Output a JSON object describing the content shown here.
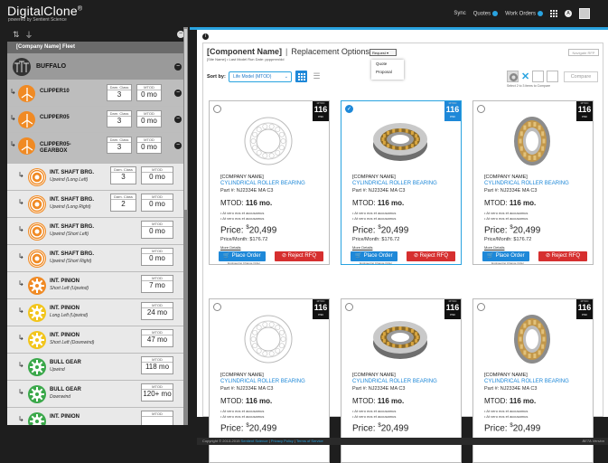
{
  "header": {
    "brand": "DigitalClone",
    "brand_mark": "®",
    "brand_sub": "powered by Sentient Science",
    "nav_label": "Sync",
    "quotes_label": "Quotes",
    "work_orders_label": "Work Orders"
  },
  "sidebar": {
    "fleet_label": "[Company Name] Fleet",
    "site_label": "BUFFALO",
    "turbines": [
      {
        "name": "CLIPPER10",
        "damage_label": "Dam. Class",
        "damage": "3",
        "mtod_label": "MTOD",
        "mtod": "0 mo"
      },
      {
        "name": "CLIPPER05",
        "damage_label": "Dam. Class",
        "damage": "3",
        "mtod_label": "MTOD",
        "mtod": "0 mo"
      },
      {
        "name": "CLIPPER05-",
        "name2": "GEARBOX",
        "damage_label": "Dam. Class",
        "damage": "3",
        "mtod_label": "MTOD",
        "mtod": "0 mo"
      }
    ],
    "components": [
      {
        "name": "INT. SHAFT BRG.",
        "sub": "Upwind (Long Left)",
        "damage_label": "Dam. Class",
        "damage": "3",
        "mtod_label": "MTOD",
        "mtod": "0 mo",
        "color": "#f08a24"
      },
      {
        "name": "INT. SHAFT BRG.",
        "sub": "Upwind (Long Right)",
        "damage_label": "Dam. Class",
        "damage": "2",
        "mtod_label": "MTOD",
        "mtod": "0 mo",
        "color": "#f08a24"
      },
      {
        "name": "INT. SHAFT BRG.",
        "sub": "Upwind (Short Left)",
        "mtod_label": "MTOD",
        "mtod": "0 mo",
        "color": "#f08a24"
      },
      {
        "name": "INT. SHAFT BRG.",
        "sub": "Upwind (Short Right)",
        "mtod_label": "MTOD",
        "mtod": "0 mo",
        "color": "#f08a24"
      },
      {
        "name": "INT. PINION",
        "sub": "Short Left (Upwind)",
        "mtod_label": "MTOD",
        "mtod": "7 mo",
        "color": "#f08a24"
      },
      {
        "name": "INT. PINION",
        "sub": "Long Left (Upwind)",
        "mtod_label": "MTOD",
        "mtod": "24 mo",
        "color": "#f2c51c"
      },
      {
        "name": "INT. PINION",
        "sub": "Short Left (Downwind)",
        "mtod_label": "MTOD",
        "mtod": "47 mo",
        "color": "#f2c51c"
      },
      {
        "name": "BULL GEAR",
        "sub": "Upwind",
        "mtod_label": "MTOD",
        "mtod": "118 mo",
        "color": "#3aa84a"
      },
      {
        "name": "BULL GEAR",
        "sub": "Downwind",
        "mtod_label": "MTOD",
        "mtod": "120+ mo",
        "color": "#3aa84a"
      },
      {
        "name": "INT. PINION",
        "sub": "",
        "mtod_label": "MTOD",
        "mtod": "",
        "color": "#3aa84a"
      }
    ]
  },
  "panel": {
    "title_company": "[Component Name]",
    "title_sep": "|",
    "title_rest": "Replacement Options",
    "subtitle": "[Site Name] • Last Model Run Date: ppppmm/dd",
    "request_label": "Request",
    "request_options": [
      "Quote",
      "Proposal"
    ],
    "nav_button": "Navigate RFP",
    "sort_label": "Sort by:",
    "sort_value": "Life Model (MTOD)",
    "compare_button": "Compare",
    "compare_caption": "Select 2 to 3 items to Compare"
  },
  "cards": [
    {
      "company": "[COMPANY NAME]",
      "title": "CYLINDRICAL ROLLER BEARING",
      "part": "Part #: NJ2334E MA C3",
      "mtod_label": "MTOD:",
      "mtod": "116 mo.",
      "bullet1": "• At vero eos et accusamus",
      "bullet2": "• At vero eos et accusamus",
      "price_label": "Price:",
      "currency": "$",
      "price": "20,499",
      "per_month": "Price/Month: $176.72",
      "more": "More Details",
      "order": "Place Order",
      "reject": "Reject RFQ",
      "eng": "Engineering Change Order",
      "badge_label": "MTOD",
      "badge_num": "116",
      "badge_unit": "mo",
      "selected": false,
      "image": "outline"
    },
    {
      "company": "[COMPANY NAME]",
      "title": "CYLINDRICAL ROLLER BEARING",
      "part": "Part #: NJ2334E MA C3",
      "mtod_label": "MTOD:",
      "mtod": "116 mo.",
      "bullet1": "• At vero eos et accusamus",
      "bullet2": "• At vero eos et accusamus",
      "price_label": "Price:",
      "currency": "$",
      "price": "20,499",
      "per_month": "Price/Month: $176.72",
      "more": "More Details",
      "order": "Place Order",
      "reject": "Reject RFQ",
      "eng": "Engineering Change Order",
      "badge_label": "MTOD",
      "badge_num": "116",
      "badge_unit": "mo",
      "selected": true,
      "image": "photo-angle"
    },
    {
      "company": "[COMPANY NAME]",
      "title": "CYLINDRICAL ROLLER BEARING",
      "part": "Part #: NJ2334E MA C3",
      "mtod_label": "MTOD:",
      "mtod": "116 mo.",
      "bullet1": "• At vero eos et accusamus",
      "bullet2": "• At vero eos et accusamus",
      "price_label": "Price:",
      "currency": "$",
      "price": "20,499",
      "per_month": "Price/Month: $176.72",
      "more": "More Details",
      "order": "Place Order",
      "reject": "Reject RFQ",
      "eng": "Engineering Change Order",
      "badge_label": "MTOD",
      "badge_num": "116",
      "badge_unit": "mo",
      "selected": false,
      "image": "photo-front"
    },
    {
      "company": "[COMPANY NAME]",
      "title": "CYLINDRICAL ROLLER BEARING",
      "part": "Part #: NJ2334E MA C3",
      "mtod_label": "MTOD:",
      "mtod": "116 mo.",
      "bullet1": "• At vero eos et accusamus",
      "bullet2": "• At vero eos et accusamus",
      "price_label": "Price:",
      "currency": "$",
      "price": "20,499",
      "badge_label": "MTOD",
      "badge_num": "116",
      "badge_unit": "mo",
      "selected": false,
      "image": "outline"
    },
    {
      "company": "[COMPANY NAME]",
      "title": "CYLINDRICAL ROLLER BEARING",
      "part": "Part #: NJ2334E MA C3",
      "mtod_label": "MTOD:",
      "mtod": "116 mo.",
      "bullet1": "• At vero eos et accusamus",
      "bullet2": "• At vero eos et accusamus",
      "price_label": "Price:",
      "currency": "$",
      "price": "20,499",
      "badge_label": "MTOD",
      "badge_num": "116",
      "badge_unit": "mo",
      "selected": false,
      "image": "photo-angle"
    },
    {
      "company": "[COMPANY NAME]",
      "title": "CYLINDRICAL ROLLER BEARING",
      "part": "Part #: NJ2334E MA C3",
      "mtod_label": "MTOD:",
      "mtod": "116 mo.",
      "bullet1": "• At vero eos et accusamus",
      "bullet2": "• At vero eos et accusamus",
      "price_label": "Price:",
      "currency": "$",
      "price": "20,499",
      "badge_label": "MTOD",
      "badge_num": "116",
      "badge_unit": "mo",
      "selected": false,
      "image": "photo-front"
    }
  ],
  "footer": {
    "copyright": "Copyright © 2013-2015",
    "company": "Sentient Science",
    "privacy": "Privacy Policy",
    "terms": "Terms of Service",
    "version": "BETA Version"
  },
  "colors": {
    "accent": "#1e88d8",
    "reject": "#d62f2f"
  }
}
